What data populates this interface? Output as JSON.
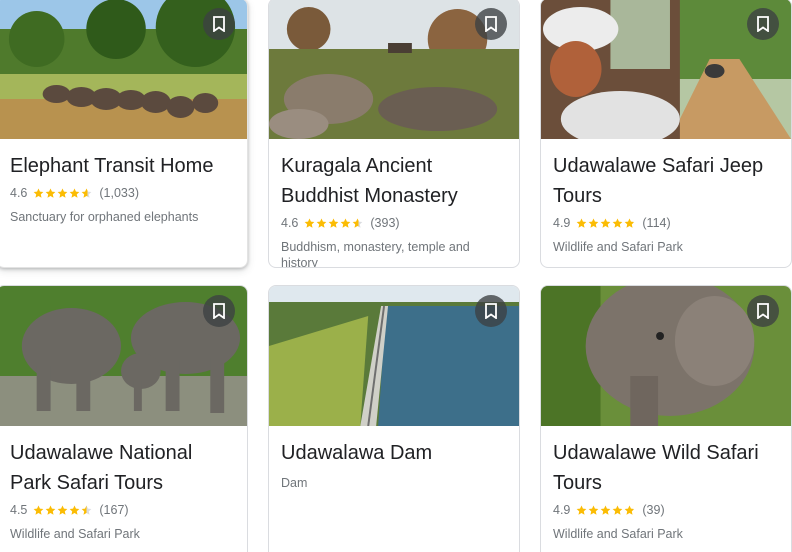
{
  "colors": {
    "star": "#fbbc04",
    "star_empty": "#dadce0",
    "title": "#202124",
    "secondary": "#70757a"
  },
  "cards": [
    {
      "title": "Elephant Transit Home",
      "rating": "4.6",
      "rating_value": 4.6,
      "reviews": "(1,033)",
      "description": "Sanctuary for orphaned elephants",
      "bookmark_icon": "bookmark-icon"
    },
    {
      "title": "Kuragala Ancient Buddhist Monastery",
      "rating": "4.6",
      "rating_value": 4.6,
      "reviews": "(393)",
      "description": "Buddhism, monastery, temple and history",
      "bookmark_icon": "bookmark-icon"
    },
    {
      "title": "Udawalawe Safari Jeep Tours",
      "rating": "4.9",
      "rating_value": 4.9,
      "reviews": "(114)",
      "description": "Wildlife and Safari Park",
      "bookmark_icon": "bookmark-icon"
    },
    {
      "title": "Udawalawe National Park Safari Tours",
      "rating": "4.5",
      "rating_value": 4.5,
      "reviews": "(167)",
      "description": "Wildlife and Safari Park",
      "bookmark_icon": "bookmark-icon"
    },
    {
      "title": "Udawalawa Dam",
      "description": "Dam",
      "bookmark_icon": "bookmark-icon"
    },
    {
      "title": "Udawalawe Wild Safari Tours",
      "rating": "4.9",
      "rating_value": 4.9,
      "reviews": "(39)",
      "description": "Wildlife and Safari Park",
      "bookmark_icon": "bookmark-icon"
    }
  ]
}
